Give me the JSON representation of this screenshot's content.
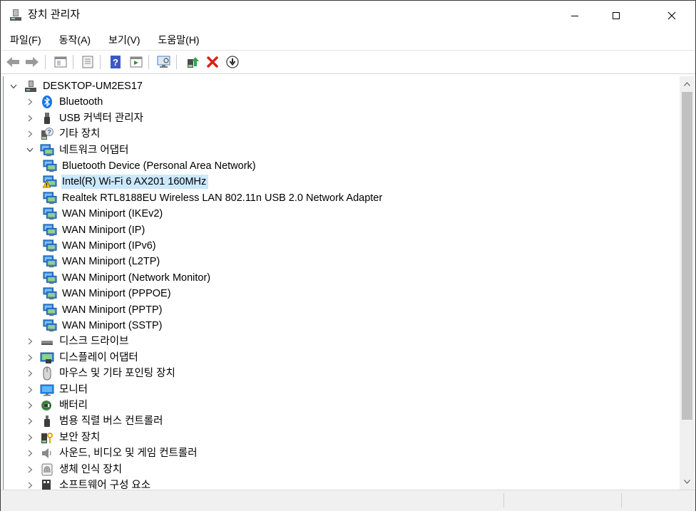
{
  "window": {
    "title": "장치 관리자"
  },
  "menu": [
    "파일(F)",
    "동작(A)",
    "보기(V)",
    "도움말(H)"
  ],
  "toolbar": [
    {
      "name": "back-icon"
    },
    {
      "name": "forward-icon"
    },
    {
      "name": "properties-icon"
    },
    {
      "name": "update-list-icon"
    },
    {
      "name": "help-icon"
    },
    {
      "name": "view-icon"
    },
    {
      "name": "monitor-icon"
    },
    {
      "name": "update-driver-icon"
    },
    {
      "name": "uninstall-icon"
    },
    {
      "name": "disable-icon"
    }
  ],
  "tree": [
    {
      "label": "DESKTOP-UM2ES17",
      "level": 0,
      "arrow": "expanded",
      "icon": "computer-icon"
    },
    {
      "label": "Bluetooth",
      "level": 1,
      "arrow": "collapsed",
      "icon": "bluetooth-icon"
    },
    {
      "label": "USB 커넥터 관리자",
      "level": 1,
      "arrow": "collapsed",
      "icon": "usb-connector-icon"
    },
    {
      "label": "기타 장치",
      "level": 1,
      "arrow": "collapsed",
      "icon": "unknown-device-icon"
    },
    {
      "label": "네트워크 어댑터",
      "level": 1,
      "arrow": "expanded",
      "icon": "network-adapter-icon"
    },
    {
      "label": "Bluetooth Device (Personal Area Network)",
      "level": 2,
      "arrow": "none",
      "icon": "network-adapter-icon"
    },
    {
      "label": "Intel(R) Wi-Fi 6 AX201 160MHz",
      "level": 2,
      "arrow": "none",
      "icon": "network-adapter-warning-icon",
      "selected": true
    },
    {
      "label": "Realtek RTL8188EU Wireless LAN 802.11n USB 2.0 Network Adapter",
      "level": 2,
      "arrow": "none",
      "icon": "network-adapter-icon"
    },
    {
      "label": "WAN Miniport (IKEv2)",
      "level": 2,
      "arrow": "none",
      "icon": "network-adapter-icon"
    },
    {
      "label": "WAN Miniport (IP)",
      "level": 2,
      "arrow": "none",
      "icon": "network-adapter-icon"
    },
    {
      "label": "WAN Miniport (IPv6)",
      "level": 2,
      "arrow": "none",
      "icon": "network-adapter-icon"
    },
    {
      "label": "WAN Miniport (L2TP)",
      "level": 2,
      "arrow": "none",
      "icon": "network-adapter-icon"
    },
    {
      "label": "WAN Miniport (Network Monitor)",
      "level": 2,
      "arrow": "none",
      "icon": "network-adapter-icon"
    },
    {
      "label": "WAN Miniport (PPPOE)",
      "level": 2,
      "arrow": "none",
      "icon": "network-adapter-icon"
    },
    {
      "label": "WAN Miniport (PPTP)",
      "level": 2,
      "arrow": "none",
      "icon": "network-adapter-icon"
    },
    {
      "label": "WAN Miniport (SSTP)",
      "level": 2,
      "arrow": "none",
      "icon": "network-adapter-icon"
    },
    {
      "label": "디스크 드라이브",
      "level": 1,
      "arrow": "collapsed",
      "icon": "disk-drive-icon"
    },
    {
      "label": "디스플레이 어댑터",
      "level": 1,
      "arrow": "collapsed",
      "icon": "display-adapter-icon"
    },
    {
      "label": "마우스 및 기타 포인팅 장치",
      "level": 1,
      "arrow": "collapsed",
      "icon": "mouse-icon"
    },
    {
      "label": "모니터",
      "level": 1,
      "arrow": "collapsed",
      "icon": "monitor-icon"
    },
    {
      "label": "배터리",
      "level": 1,
      "arrow": "collapsed",
      "icon": "battery-icon"
    },
    {
      "label": "범용 직렬 버스 컨트롤러",
      "level": 1,
      "arrow": "collapsed",
      "icon": "usb-controller-icon"
    },
    {
      "label": "보안 장치",
      "level": 1,
      "arrow": "collapsed",
      "icon": "security-device-icon"
    },
    {
      "label": "사운드, 비디오 및 게임 컨트롤러",
      "level": 1,
      "arrow": "collapsed",
      "icon": "sound-icon"
    },
    {
      "label": "생체 인식 장치",
      "level": 1,
      "arrow": "collapsed",
      "icon": "fingerprint-icon"
    },
    {
      "label": "소프트웨어 구성 요소",
      "level": 1,
      "arrow": "collapsed",
      "icon": "software-component-icon"
    }
  ],
  "colors": {
    "selection": "#cce8ff",
    "net_green": "#3a8f3a",
    "net_blue": "#2e7dd6"
  }
}
